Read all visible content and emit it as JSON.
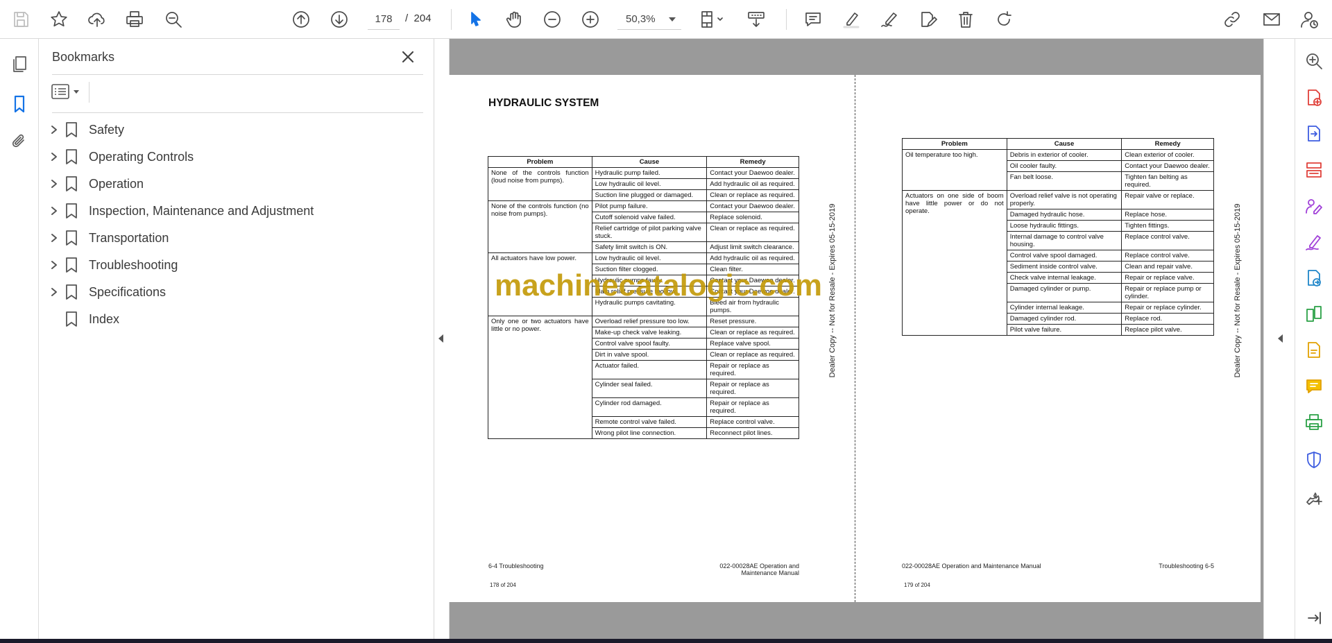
{
  "toolbar": {
    "page_current": "178",
    "page_sep": "/",
    "page_total": "204",
    "zoom": "50,3%"
  },
  "bookmarks": {
    "title": "Bookmarks",
    "items": [
      {
        "label": "Safety",
        "expandable": true
      },
      {
        "label": "Operating Controls",
        "expandable": true
      },
      {
        "label": "Operation",
        "expandable": true
      },
      {
        "label": "Inspection, Maintenance and Adjustment",
        "expandable": true
      },
      {
        "label": "Transportation",
        "expandable": true
      },
      {
        "label": "Troubleshooting",
        "expandable": true
      },
      {
        "label": "Specifications",
        "expandable": true
      },
      {
        "label": "Index",
        "expandable": false
      }
    ]
  },
  "document": {
    "left_page": {
      "title": "HYDRAULIC SYSTEM",
      "headers": [
        "Problem",
        "Cause",
        "Remedy"
      ],
      "groups": [
        {
          "problem": "None of the controls function (loud noise from pumps).",
          "rows": [
            [
              "Hydraulic pump failed.",
              "Contact your Daewoo dealer."
            ],
            [
              "Low hydraulic oil level.",
              "Add hydraulic oil as required."
            ],
            [
              "Suction line plugged or damaged.",
              "Clean or replace as required."
            ]
          ]
        },
        {
          "problem": "None of the controls function (no noise from pumps).",
          "rows": [
            [
              "Pilot pump failure.",
              "Contact your Daewoo dealer."
            ],
            [
              "Cutoff solenoid valve failed.",
              "Replace solenoid."
            ],
            [
              "Relief cartridge of pilot parking valve stuck.",
              "Clean or replace as required."
            ],
            [
              "Safety limit switch is ON.",
              "Adjust limit switch clearance."
            ]
          ]
        },
        {
          "problem": "All actuators have low power.",
          "rows": [
            [
              "Low hydraulic oil level.",
              "Add hydraulic oil as required."
            ],
            [
              "Suction filter clogged.",
              "Clean filter."
            ],
            [
              "Hydraulic pumps faulty.",
              "Contact your Daewoo dealer."
            ],
            [
              "Main relief pressure too low.",
              "Contact your Daewoo dealer."
            ],
            [
              "Hydraulic pumps cavitating.",
              "Bleed air from hydraulic pumps."
            ]
          ]
        },
        {
          "problem": "Only one or two actuators have little or no power.",
          "rows": [
            [
              "Overload relief pressure too low.",
              "Reset pressure."
            ],
            [
              "Make-up check valve leaking.",
              "Clean or replace as required."
            ],
            [
              "Control valve spool faulty.",
              "Replace valve spool."
            ],
            [
              "Dirt in valve spool.",
              "Clean or replace as required."
            ],
            [
              "Actuator failed.",
              "Repair or replace as required."
            ],
            [
              "Cylinder seal failed.",
              "Repair or replace as required."
            ],
            [
              "Cylinder rod damaged.",
              "Repair or replace as required."
            ],
            [
              "Remote control valve failed.",
              "Replace control valve."
            ],
            [
              "Wrong pilot line connection.",
              "Reconnect pilot lines."
            ]
          ]
        }
      ],
      "footer_left": "6-4  Troubleshooting",
      "footer_right": "022-00028AE Operation and Maintenance Manual",
      "page_label": "178 of 204",
      "side_text": "Dealer Copy -- Not for Resale - Expires 05-15-2019"
    },
    "right_page": {
      "headers": [
        "Problem",
        "Cause",
        "Remedy"
      ],
      "groups": [
        {
          "problem": "Oil temperature too high.",
          "rows": [
            [
              "Debris in exterior of cooler.",
              "Clean exterior of cooler."
            ],
            [
              "Oil cooler faulty.",
              "Contact your Daewoo dealer."
            ],
            [
              "Fan belt loose.",
              "Tighten fan belting as required."
            ]
          ]
        },
        {
          "problem": "Actuators on one side of boom have little power or do not operate.",
          "rows": [
            [
              "Overload relief valve is not operating properly.",
              "Repair valve or replace."
            ],
            [
              "Damaged hydraulic hose.",
              "Replace hose."
            ],
            [
              "Loose hydraulic fittings.",
              "Tighten fittings."
            ],
            [
              "Internal damage to control valve housing.",
              "Replace control valve."
            ],
            [
              "Control valve spool damaged.",
              "Replace control valve."
            ],
            [
              "Sediment inside control valve.",
              "Clean and repair valve."
            ],
            [
              "Check valve internal leakage.",
              "Repair or replace valve."
            ],
            [
              "Damaged cylinder or pump.",
              "Repair or replace pump or cylinder."
            ],
            [
              "Cylinder internal leakage.",
              "Repair or replace cylinder."
            ],
            [
              "Damaged cylinder rod.",
              "Replace rod."
            ],
            [
              "Pilot valve failure.",
              "Replace pilot valve."
            ]
          ]
        }
      ],
      "footer_left": "022-00028AE Operation and Maintenance Manual",
      "footer_right": "Troubleshooting 6-5",
      "page_label": "179 of 204",
      "side_text": "Dealer Copy -- Not for Resale - Expires 05-15-2019"
    },
    "watermark": "machinecatalogic.com"
  },
  "colors": {
    "accent_blue": "#1473e6",
    "watermark": "#c49b0a",
    "viewer_bg": "#9a9a9a"
  }
}
